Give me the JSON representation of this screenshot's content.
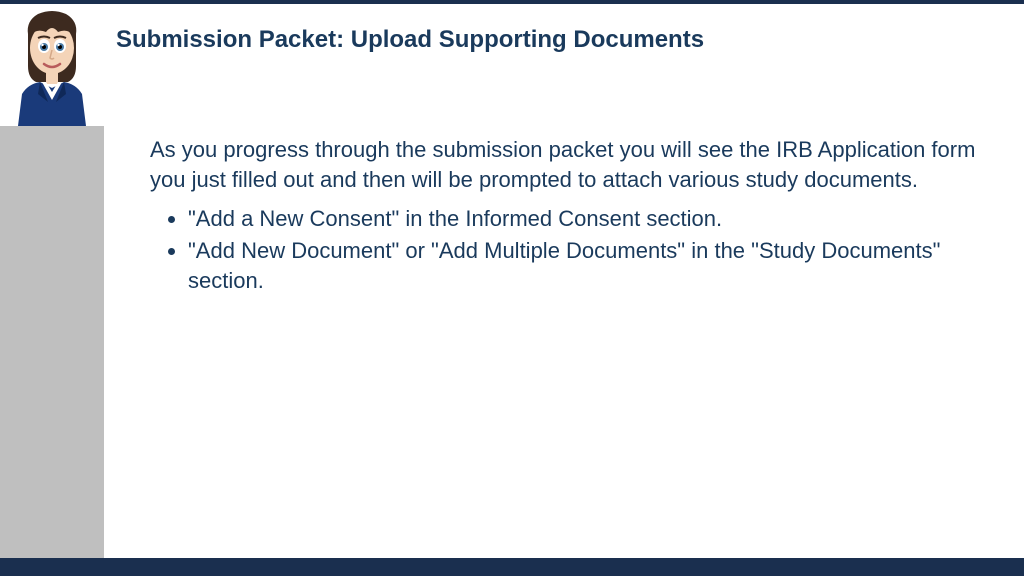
{
  "title": "Submission Packet: Upload Supporting Documents",
  "intro": "As you progress through the submission packet you will see the IRB Application form you just filled out and then will be prompted to attach various study documents.",
  "bullets": [
    "\"Add a New Consent\" in the Informed Consent section.",
    "\"Add New Document\" or \"Add Multiple Documents\" in the \"Study Documents\" section."
  ]
}
